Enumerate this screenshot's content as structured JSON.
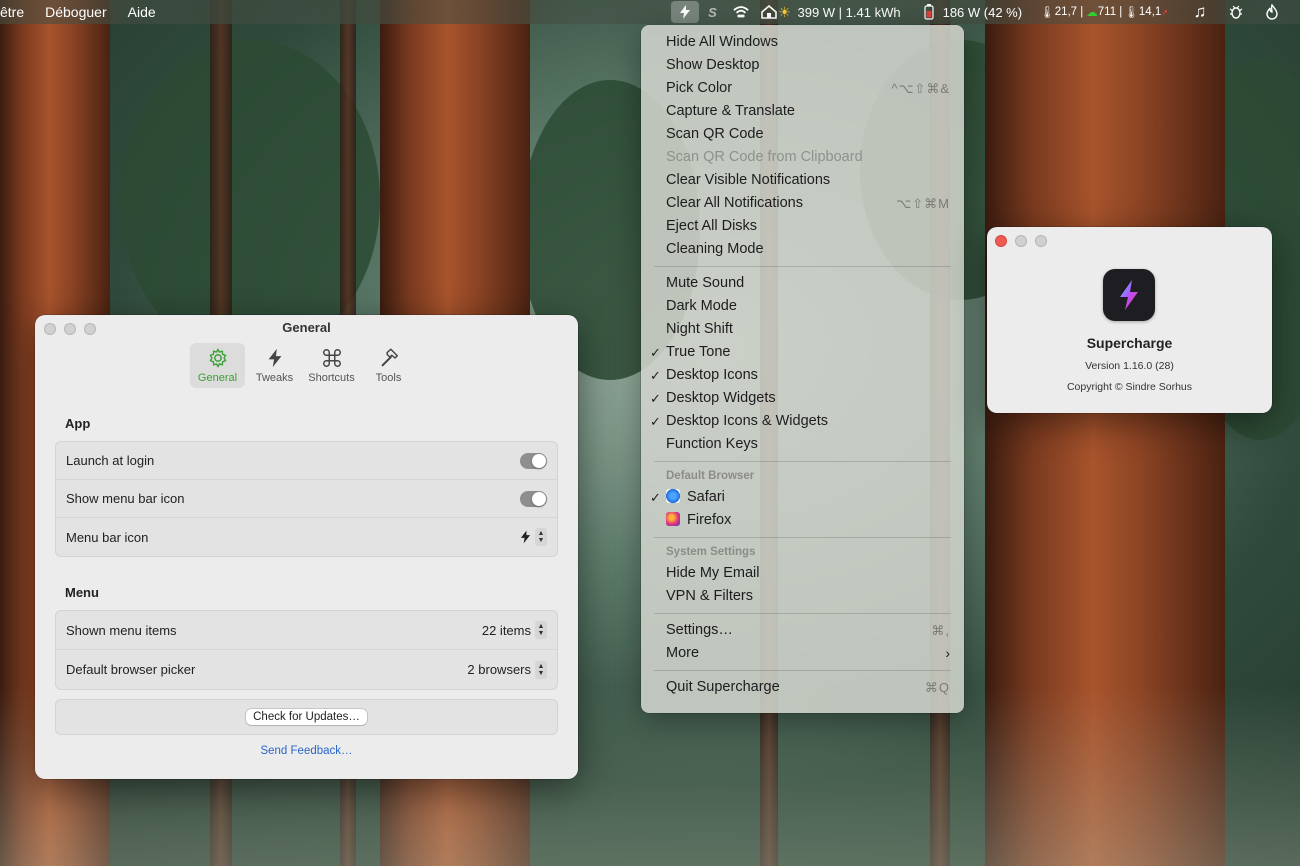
{
  "menubar": {
    "left_items": [
      "être",
      "Déboguer",
      "Aide"
    ],
    "status": {
      "solar": "399 W | 1.41 kWh",
      "battery": "186 W (42 %)",
      "temp1": "21,7 |",
      "co2": "711 |",
      "temp2": "14,1"
    }
  },
  "menu": {
    "items_1": [
      {
        "label": "Hide All Windows",
        "shortcut": ""
      },
      {
        "label": "Show Desktop",
        "shortcut": ""
      },
      {
        "label": "Pick Color",
        "shortcut": "^⌥⇧⌘&"
      },
      {
        "label": "Capture & Translate",
        "shortcut": ""
      },
      {
        "label": "Scan QR Code",
        "shortcut": ""
      },
      {
        "label": "Scan QR Code from Clipboard",
        "shortcut": ""
      },
      {
        "label": "Clear Visible Notifications",
        "shortcut": ""
      },
      {
        "label": "Clear All Notifications",
        "shortcut": "⌥⇧⌘M"
      },
      {
        "label": "Eject All Disks",
        "shortcut": ""
      },
      {
        "label": "Cleaning Mode",
        "shortcut": ""
      }
    ],
    "items_2": [
      {
        "label": "Mute Sound"
      },
      {
        "label": "Dark Mode"
      },
      {
        "label": "Night Shift"
      },
      {
        "label": "True Tone"
      },
      {
        "label": "Desktop Icons"
      },
      {
        "label": "Desktop Widgets"
      },
      {
        "label": "Desktop Icons & Widgets"
      },
      {
        "label": "Function Keys"
      }
    ],
    "browser_header": "Default Browser",
    "browsers": [
      {
        "label": "Safari"
      },
      {
        "label": "Firefox"
      }
    ],
    "system_header": "System Settings",
    "system_items": [
      {
        "label": "Hide My Email"
      },
      {
        "label": "VPN & Filters"
      }
    ],
    "settings": {
      "label": "Settings…",
      "shortcut": "⌘,"
    },
    "more": {
      "label": "More"
    },
    "quit": {
      "label": "Quit Supercharge",
      "shortcut": "⌘Q"
    }
  },
  "general": {
    "title": "General",
    "tabs": [
      "General",
      "Tweaks",
      "Shortcuts",
      "Tools"
    ],
    "app_section": "App",
    "launch_at_login": "Launch at login",
    "show_menu_bar_icon": "Show menu bar icon",
    "menu_bar_icon": "Menu bar icon",
    "menu_section": "Menu",
    "shown_menu_items": "Shown menu items",
    "shown_menu_items_value": "22 items",
    "default_browser_picker": "Default browser picker",
    "default_browser_picker_value": "2 browsers",
    "check_updates": "Check for Updates…",
    "send_feedback": "Send Feedback…"
  },
  "about": {
    "name": "Supercharge",
    "version": "Version 1.16.0 (28)",
    "copyright": "Copyright © Sindre Sorhus"
  },
  "colors": {
    "accent_green": "#3aa033",
    "link_blue": "#2a66c9",
    "close_red": "#ee5b53"
  }
}
